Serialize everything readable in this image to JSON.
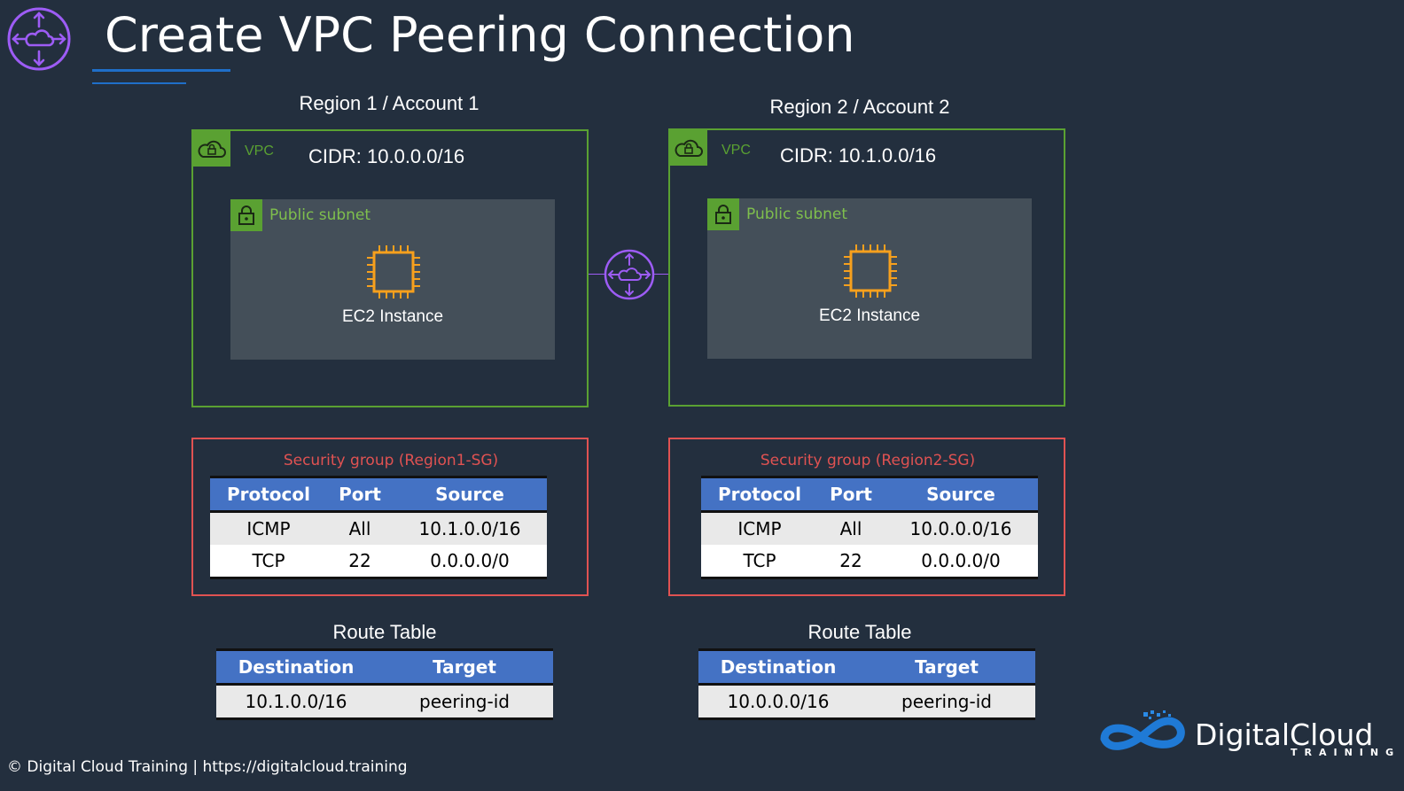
{
  "header": {
    "title": "Create VPC Peering Connection"
  },
  "regions": [
    {
      "title": "Region 1 / Account 1",
      "vpc_label": "VPC",
      "cidr": "CIDR: 10.0.0.0/16",
      "subnet_label": "Public subnet",
      "instance_label": "EC2 Instance",
      "security_group": {
        "title": "Security group  (Region1-SG)",
        "headers": [
          "Protocol",
          "Port",
          "Source"
        ],
        "rows": [
          [
            "ICMP",
            "All",
            "10.1.0.0/16"
          ],
          [
            "TCP",
            "22",
            "0.0.0.0/0"
          ]
        ]
      },
      "route_table": {
        "title": "Route Table",
        "headers": [
          "Destination",
          "Target"
        ],
        "rows": [
          [
            "10.1.0.0/16",
            "peering-id"
          ]
        ]
      }
    },
    {
      "title": "Region 2 / Account 2",
      "vpc_label": "VPC",
      "cidr": "CIDR: 10.1.0.0/16",
      "subnet_label": "Public subnet",
      "instance_label": "EC2 Instance",
      "security_group": {
        "title": "Security group (Region2-SG)",
        "headers": [
          "Protocol",
          "Port",
          "Source"
        ],
        "rows": [
          [
            "ICMP",
            "All",
            "10.0.0.0/16"
          ],
          [
            "TCP",
            "22",
            "0.0.0.0/0"
          ]
        ]
      },
      "route_table": {
        "title": "Route Table",
        "headers": [
          "Destination",
          "Target"
        ],
        "rows": [
          [
            "10.0.0.0/16",
            "peering-id"
          ]
        ]
      }
    }
  ],
  "footer": {
    "text": "© Digital Cloud Training  | https://digitalcloud.training"
  },
  "brand": {
    "name": "DigitalCloud",
    "sub": "TRAINING"
  },
  "colors": {
    "background": "#232f3e",
    "vpc_green": "#5aa132",
    "sg_red": "#e05252",
    "table_header": "#4472c4",
    "peering_purple": "#9d5cf5",
    "ec2_orange": "#f7a01d"
  },
  "icons": [
    "vpc-peering-icon",
    "vpc-cloud-icon",
    "subnet-lock-icon",
    "ec2-chip-icon",
    "brand-logo-icon"
  ]
}
